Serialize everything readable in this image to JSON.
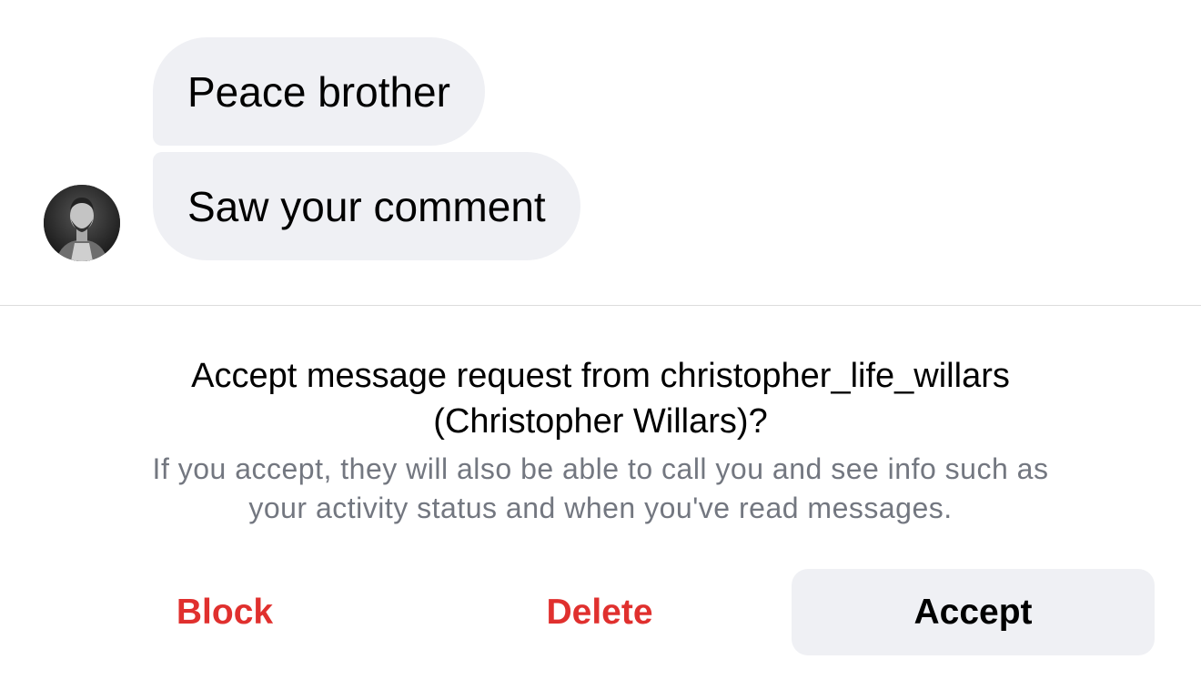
{
  "messages": [
    {
      "text": "Peace brother"
    },
    {
      "text": "Saw your comment"
    }
  ],
  "sender": {
    "avatar_icon": "profile-photo"
  },
  "request": {
    "title_line1": "Accept message request from christopher_life_willars",
    "title_line2": "(Christopher Willars)?",
    "subtitle_line1": "If you accept, they will also be able to call you and see info such as",
    "subtitle_line2": "your activity status and when you've read messages."
  },
  "actions": {
    "block_label": "Block",
    "delete_label": "Delete",
    "accept_label": "Accept"
  },
  "colors": {
    "bubble_bg": "#eff0f4",
    "destructive": "#e0302e",
    "secondary_text": "#737780"
  }
}
